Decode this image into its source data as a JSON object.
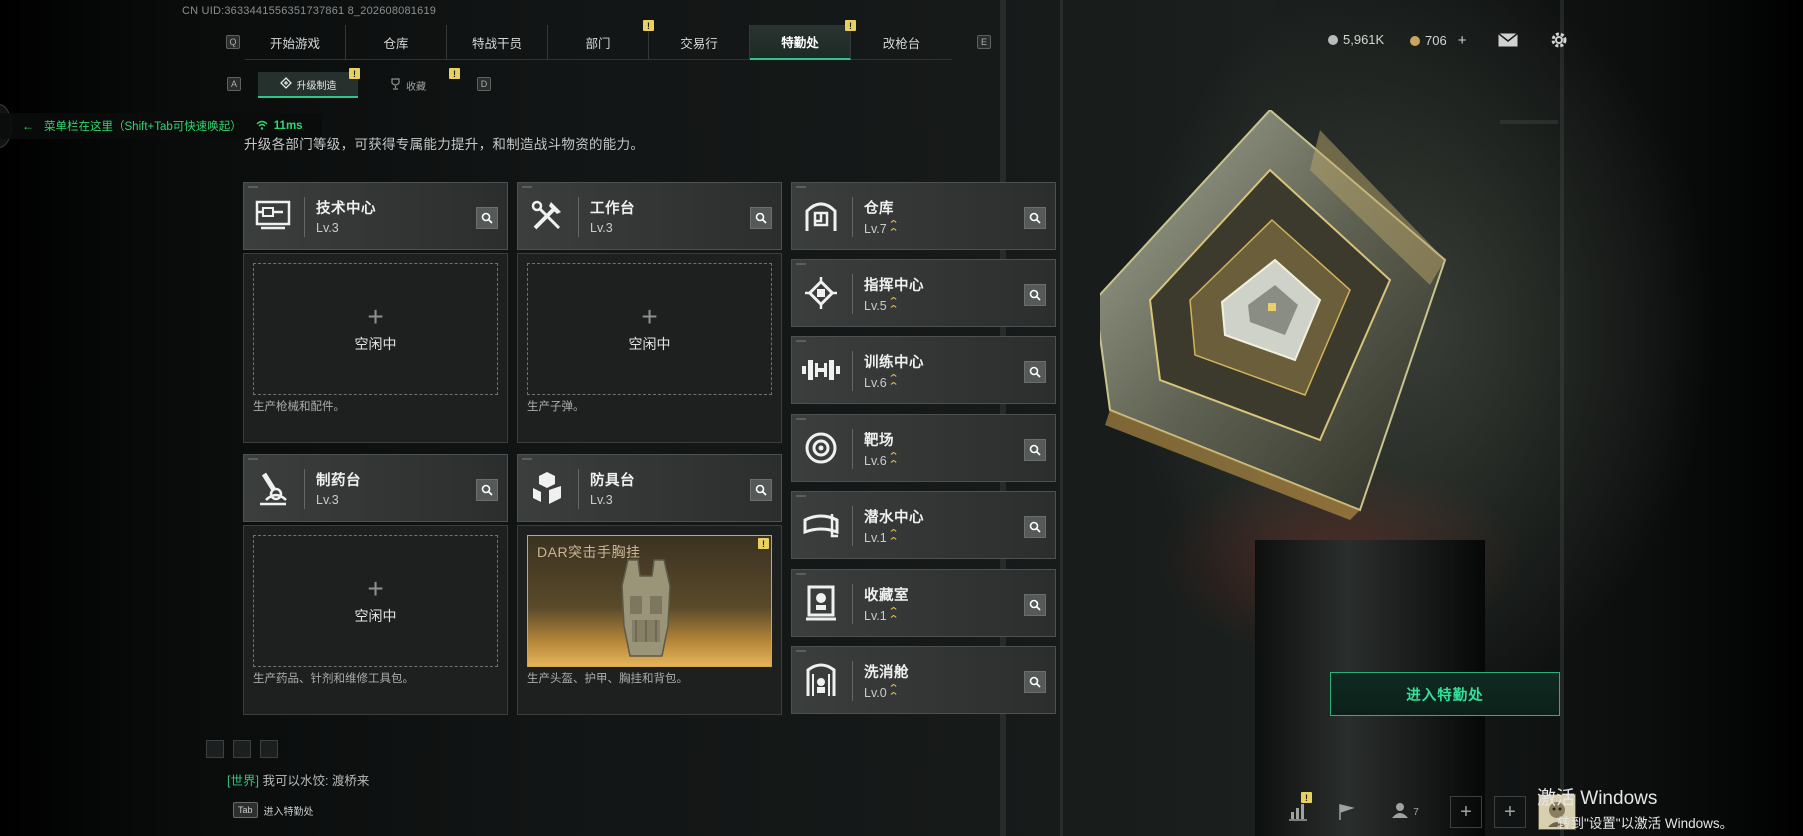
{
  "uid": "CN UID:3633441556351737861 8_202608081619",
  "main_tabs": {
    "left_key": "Q",
    "right_key": "E",
    "items": [
      {
        "label": "开始游戏"
      },
      {
        "label": "仓库"
      },
      {
        "label": "特战干员"
      },
      {
        "label": "部门"
      },
      {
        "label": "交易行"
      },
      {
        "label": "特勤处",
        "active": true
      },
      {
        "label": "改枪台"
      }
    ],
    "notice_mark": "!"
  },
  "sub_tabs": {
    "left_key": "A",
    "right_key": "D",
    "items": [
      {
        "label": "升级制造",
        "active": true,
        "icon": "upgrade-icon"
      },
      {
        "label": "收藏",
        "icon": "trophy-icon"
      }
    ]
  },
  "currency": {
    "silver": "5,961K",
    "gold": "706",
    "gold_add": "+",
    "silver_color": "#b9bcbb",
    "gold_color": "#c9a560"
  },
  "overlay": {
    "menu_hint": "菜单栏在这里（Shift+Tab可快速唤起）",
    "ping": "11ms"
  },
  "subtitle": "升级各部门等级，可获得专属能力提升，和制造战斗物资的能力。",
  "production": [
    {
      "name": "技术中心",
      "level": "Lv.3",
      "icon": "tech-center-icon",
      "slot_state": "空闲中",
      "desc": "生产枪械和配件。"
    },
    {
      "name": "工作台",
      "level": "Lv.3",
      "icon": "workbench-icon",
      "slot_state": "空闲中",
      "desc": "生产子弹。"
    },
    {
      "name": "制药台",
      "level": "Lv.3",
      "icon": "pharmacy-icon",
      "slot_state": "空闲中",
      "desc": "生产药品、针剂和维修工具包。"
    },
    {
      "name": "防具台",
      "level": "Lv.3",
      "icon": "armor-bench-icon",
      "slot_item": "DAR突击手胸挂",
      "desc": "生产头盔、护甲、胸挂和背包。"
    }
  ],
  "facilities": [
    {
      "name": "仓库",
      "level": "Lv.7",
      "icon": "warehouse-icon"
    },
    {
      "name": "指挥中心",
      "level": "Lv.5",
      "icon": "command-center-icon"
    },
    {
      "name": "训练中心",
      "level": "Lv.6",
      "icon": "training-center-icon"
    },
    {
      "name": "靶场",
      "level": "Lv.6",
      "icon": "shooting-range-icon"
    },
    {
      "name": "潜水中心",
      "level": "Lv.1",
      "icon": "diving-center-icon"
    },
    {
      "name": "收藏室",
      "level": "Lv.1",
      "icon": "collection-room-icon"
    },
    {
      "name": "洗消舱",
      "level": "Lv.0",
      "icon": "decon-chamber-icon"
    }
  ],
  "enter_button": "进入特勤处",
  "chat": {
    "channel": "[世界]",
    "message": "我可以水饺: 渡桥来"
  },
  "tab_hint": {
    "key": "Tab",
    "label": "进入特勤处"
  },
  "friends_count": "7",
  "watermark": {
    "line1": "激活 Windows",
    "line2": "转到\"设置\"以激活 Windows。"
  },
  "accent_color": "#29c88a",
  "upgrade_color": "#e8c34a"
}
